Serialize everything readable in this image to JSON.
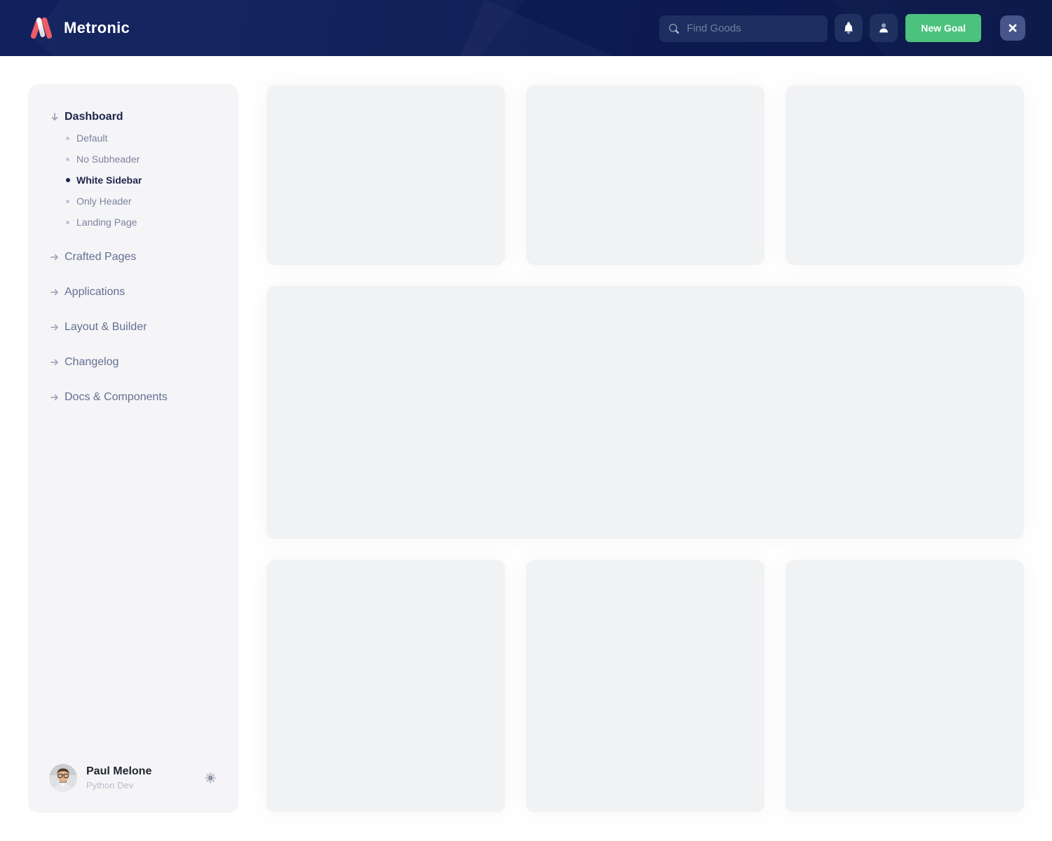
{
  "header": {
    "brand": "Metronic",
    "search": {
      "placeholder": "Find Goods"
    },
    "actions": {
      "new_goal_label": "New Goal"
    },
    "colors": {
      "background": "#0c1b52",
      "accent_green": "#4bc27d",
      "logo_coral": "#f05b68",
      "control_bg": "#1e3160",
      "close_bg": "#46568a"
    }
  },
  "sidebar": {
    "background": "#f5f5f8",
    "sections": [
      {
        "label": "Dashboard",
        "icon": "arrow-down-icon",
        "expanded": true,
        "children": [
          {
            "label": "Default",
            "active": false
          },
          {
            "label": "No Subheader",
            "active": false
          },
          {
            "label": "White Sidebar",
            "active": true
          },
          {
            "label": "Only Header",
            "active": false
          },
          {
            "label": "Landing Page",
            "active": false
          }
        ]
      },
      {
        "label": "Crafted Pages",
        "icon": "arrow-right-icon"
      },
      {
        "label": "Applications",
        "icon": "arrow-right-icon"
      },
      {
        "label": "Layout & Builder",
        "icon": "arrow-right-icon"
      },
      {
        "label": "Changelog",
        "icon": "arrow-right-icon"
      },
      {
        "label": "Docs & Components",
        "icon": "arrow-right-icon"
      }
    ],
    "profile": {
      "name": "Paul Melone",
      "role": "Python Dev"
    }
  },
  "main": {
    "placeholder_cards": {
      "top_row_count": 3,
      "middle_count": 1,
      "bottom_row_count": 3,
      "card_color": "#f1f2f4"
    }
  }
}
